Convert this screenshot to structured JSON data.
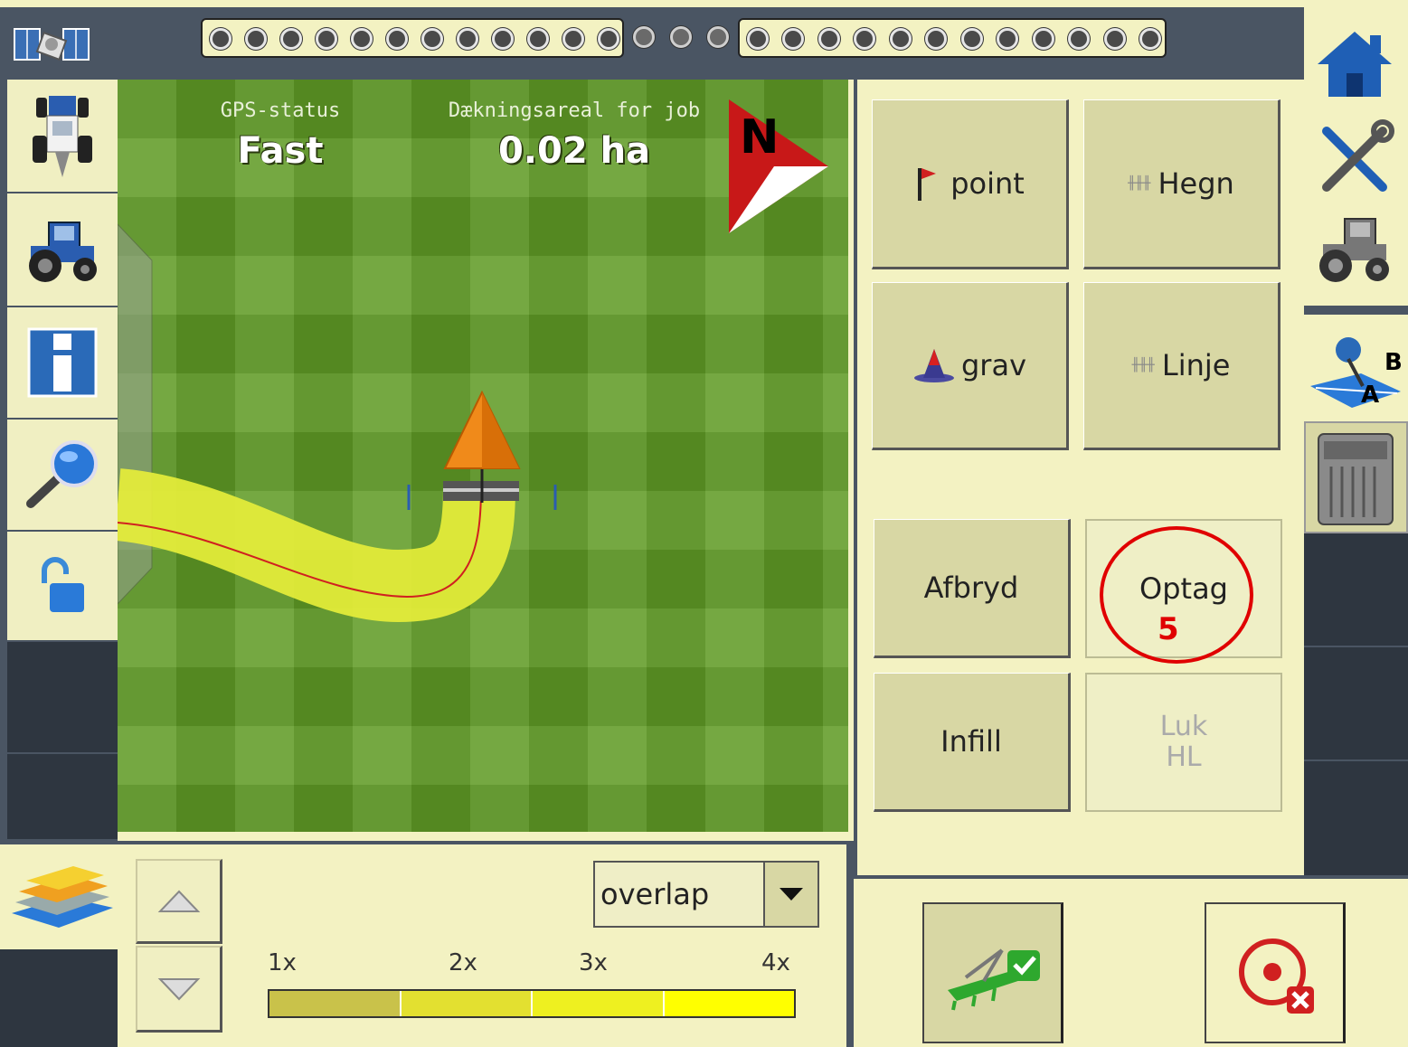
{
  "top_bar": {
    "left_section_count": 12,
    "middle_section_count": 3,
    "right_section_count": 12
  },
  "map": {
    "gps_status_label": "GPS-status",
    "gps_status_value": "Fast",
    "coverage_label": "Dækningsareal for job",
    "coverage_value": "0.02 ha",
    "north_label": "N"
  },
  "panel": {
    "buttons": {
      "point": "point",
      "hegn": "Hegn",
      "grav": "grav",
      "linje": "Linje",
      "afbryd": "Afbryd",
      "optag": "Optag",
      "infill": "Infill",
      "luk_line1": "Luk",
      "luk_line2": "HL"
    },
    "annotation_number": "5"
  },
  "ab_icon_labels": {
    "a": "A",
    "b": "B"
  },
  "legend": {
    "dropdown_value": "overlap",
    "labels": [
      "1x",
      "2x",
      "3x",
      "4x"
    ],
    "colors": [
      "#c9c24a",
      "#e3e030",
      "#eef020",
      "#ffff00"
    ]
  },
  "colors": {
    "bar": "#4a5563",
    "panel_bg": "#f3f2c2",
    "field": "#5f9a25",
    "coverage": "#e6ee3a",
    "annotation": "#e00000"
  }
}
